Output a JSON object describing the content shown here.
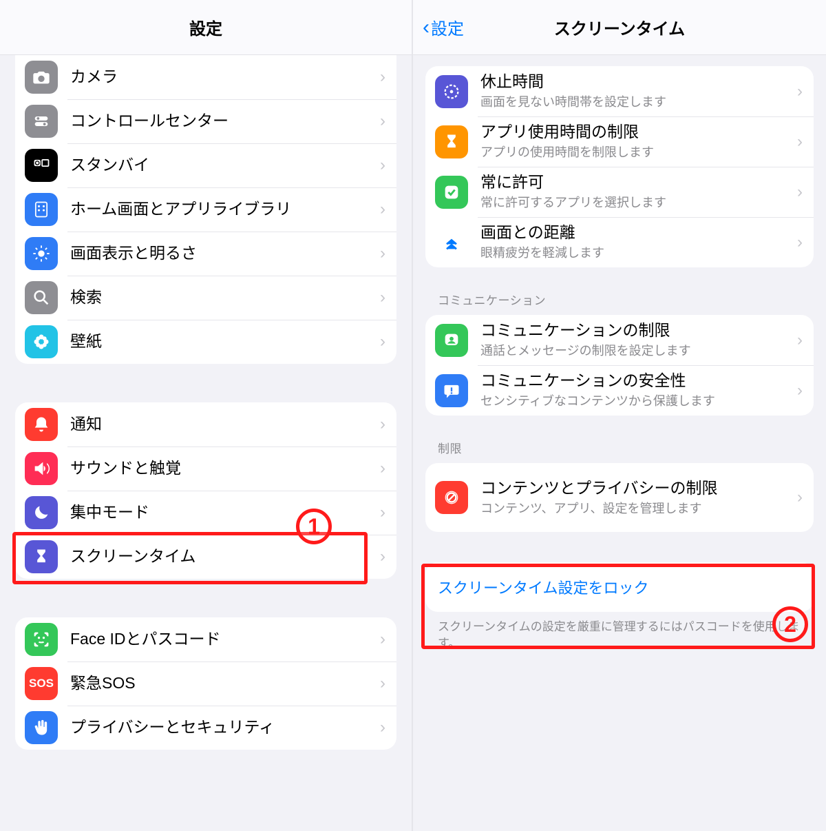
{
  "left": {
    "title": "設定",
    "group1": [
      {
        "label": "カメラ"
      },
      {
        "label": "コントロールセンター"
      },
      {
        "label": "スタンバイ"
      },
      {
        "label": "ホーム画面とアプリライブラリ"
      },
      {
        "label": "画面表示と明るさ"
      },
      {
        "label": "検索"
      },
      {
        "label": "壁紙"
      }
    ],
    "group2": [
      {
        "label": "通知"
      },
      {
        "label": "サウンドと触覚"
      },
      {
        "label": "集中モード"
      },
      {
        "label": "スクリーンタイム"
      }
    ],
    "group3": [
      {
        "label": "Face IDとパスコード"
      },
      {
        "label": "緊急SOS"
      },
      {
        "label": "プライバシーとセキュリティ"
      }
    ]
  },
  "right": {
    "back": "設定",
    "title": "スクリーンタイム",
    "groupA": [
      {
        "label": "休止時間",
        "sub": "画面を見ない時間帯を設定します"
      },
      {
        "label": "アプリ使用時間の制限",
        "sub": "アプリの使用時間を制限します"
      },
      {
        "label": "常に許可",
        "sub": "常に許可するアプリを選択します"
      },
      {
        "label": "画面との距離",
        "sub": "眼精疲労を軽減します"
      }
    ],
    "sectionB": "コミュニケーション",
    "groupB": [
      {
        "label": "コミュニケーションの制限",
        "sub": "通話とメッセージの制限を設定します"
      },
      {
        "label": "コミュニケーションの安全性",
        "sub": "センシティブなコンテンツから保護します"
      }
    ],
    "sectionC": "制限",
    "groupC": [
      {
        "label": "コンテンツとプライバシーの制限",
        "sub": "コンテンツ、アプリ、設定を管理します"
      }
    ],
    "lockLink": "スクリーンタイム設定をロック",
    "footer": "スクリーンタイムの設定を厳重に管理するにはパスコードを使用します。"
  },
  "annotations": {
    "badge1": "1",
    "badge2": "2"
  }
}
